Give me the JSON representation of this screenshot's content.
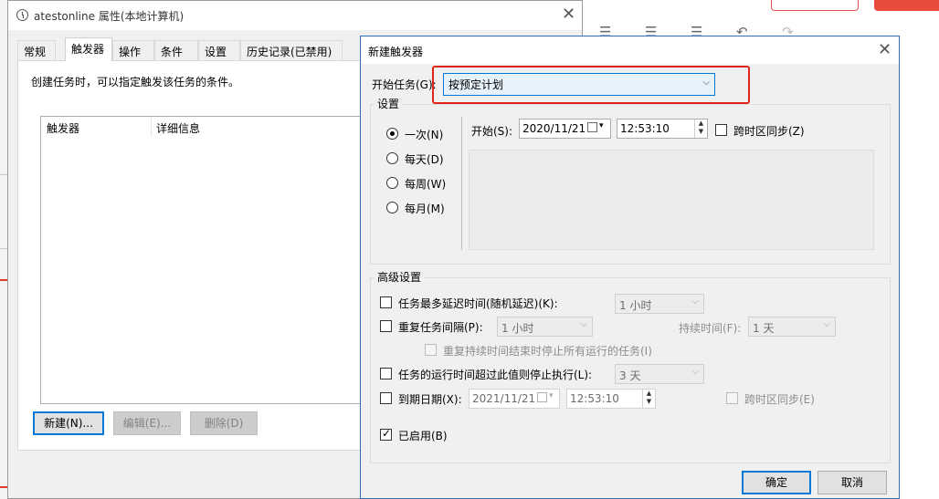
{
  "main_window": {
    "title": "atestonline 属性(本地计算机)",
    "tabs": [
      "常规",
      "触发器",
      "操作",
      "条件",
      "设置",
      "历史记录(已禁用)"
    ],
    "active_tab": "触发器",
    "description": "创建任务时，可以指定触发该任务的条件。",
    "list_columns": [
      "触发器",
      "详细信息"
    ],
    "buttons": {
      "new": "新建(N)...",
      "edit": "编辑(E)...",
      "delete": "删除(D)"
    }
  },
  "dialog": {
    "title": "新建触发器",
    "begin_task_label": "开始任务(G):",
    "begin_task_value": "按预定计划",
    "settings_group": "设置",
    "schedule_options": [
      {
        "label": "一次(N)",
        "checked": true
      },
      {
        "label": "每天(D)",
        "checked": false
      },
      {
        "label": "每周(W)",
        "checked": false
      },
      {
        "label": "每月(M)",
        "checked": false
      }
    ],
    "start_label": "开始(S):",
    "start_date": "2020/11/21",
    "start_time": "12:53:10",
    "sync_timezone": "跨时区同步(Z)",
    "advanced_group": "高级设置",
    "delay": {
      "label": "任务最多延迟时间(随机延迟)(K):",
      "value": "1 小时",
      "checked": false
    },
    "repeat": {
      "label": "重复任务间隔(P):",
      "value": "1 小时",
      "checked": false
    },
    "duration": {
      "label": "持续时间(F):",
      "value": "1 天"
    },
    "stop_repeat": {
      "label": "重复持续时间结束时停止所有运行的任务(I)",
      "checked": false
    },
    "stop_after": {
      "label": "任务的运行时间超过此值则停止执行(L):",
      "value": "3 天",
      "checked": false
    },
    "expire": {
      "label": "到期日期(X):",
      "date": "2021/11/21",
      "time": "12:53:10",
      "checked": false
    },
    "expire_sync": "跨时区同步(E)",
    "enabled": {
      "label": "已启用(B)",
      "checked": true
    },
    "ok": "确定",
    "cancel": "取消"
  },
  "colors": {
    "highlight_box": "#e2231a",
    "accent": "#0078d7",
    "window_bg": "#f0f0f0"
  }
}
